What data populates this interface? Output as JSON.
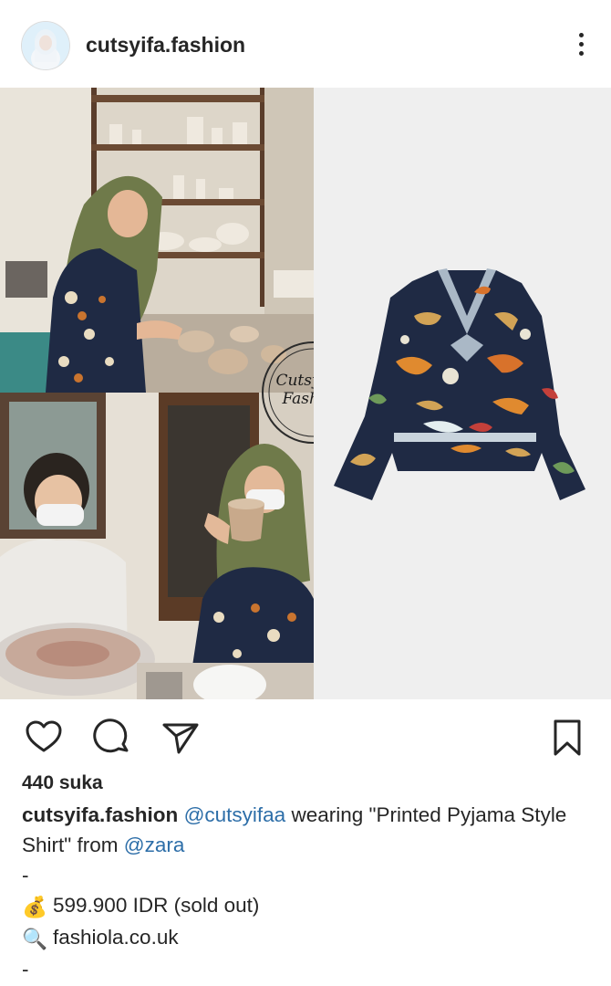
{
  "header": {
    "username": "cutsyifa.fashion",
    "avatar_icon": "profile-avatar",
    "more_icon": "more-vertical-icon"
  },
  "post": {
    "watermark_line1": "Cutsyifaa",
    "watermark_line2": "Fashion"
  },
  "actions": {
    "like_icon": "heart-icon",
    "comment_icon": "comment-icon",
    "share_icon": "send-icon",
    "save_icon": "bookmark-icon"
  },
  "likes_text": "440 suka",
  "caption": {
    "username": "cutsyifa.fashion",
    "mention_1": "@cutsyifaa",
    "text_1": " wearing \"Printed Pyjama Style",
    "text_2": "Shirt\" from ",
    "mention_2": "@zara",
    "dash_1": "-",
    "price_emoji": "💰",
    "price_text": "599.900 IDR (sold out)",
    "search_emoji": "🔍",
    "site_text": "fashiola.co.uk",
    "dash_2": "-"
  },
  "colors": {
    "text": "#262626",
    "mention": "#2d6ea8",
    "hijab": "#6f7a4a",
    "shirt": "#1f2a44",
    "background": "#efefef"
  }
}
